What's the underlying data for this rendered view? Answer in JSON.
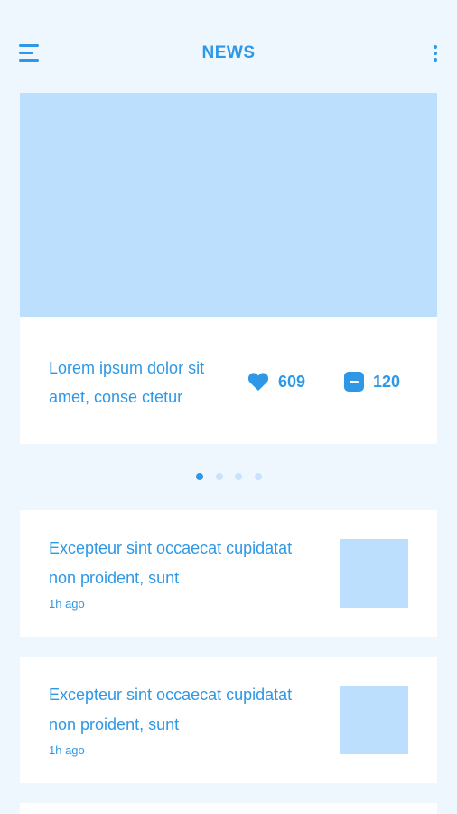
{
  "header": {
    "title": "NEWS",
    "menu_icon": "hamburger-menu-icon",
    "more_icon": "vertical-dots-icon"
  },
  "featured": {
    "text": "Lorem ipsum dolor sit amet, conse ctetur",
    "likes": "609",
    "comments": "120",
    "like_icon": "heart-icon",
    "comment_icon": "comment-icon"
  },
  "carousel": {
    "count": 4,
    "active_index": 0
  },
  "news": [
    {
      "title": "Excepteur sint occaecat cupidatat non proident, sunt",
      "time": "1h ago"
    },
    {
      "title": "Excepteur sint occaecat cupidatat non proident, sunt",
      "time": "1h ago"
    }
  ],
  "colors": {
    "accent": "#2e98e6",
    "background": "#eef7fe",
    "placeholder": "#bbdffd",
    "dot_inactive": "#c8e3fb"
  }
}
